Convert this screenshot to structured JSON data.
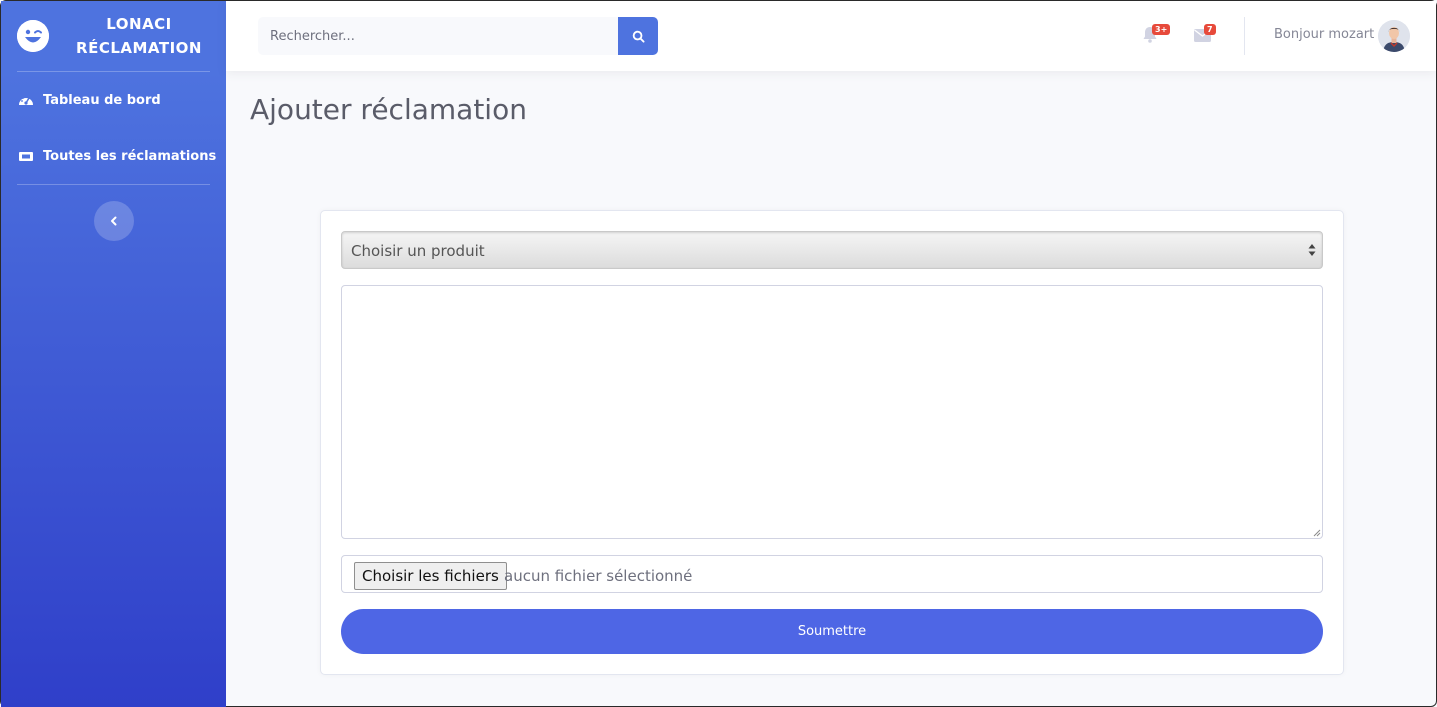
{
  "brand": {
    "line1": "LONACI",
    "line2": "RÉCLAMATION",
    "icon": "laugh-wink-icon"
  },
  "sidebar": {
    "items": [
      {
        "label": "Tableau de bord",
        "icon": "tachometer-icon"
      },
      {
        "label": "Toutes les réclamations",
        "icon": "ticket-icon"
      }
    ],
    "toggle_icon": "chevron-left-icon"
  },
  "topbar": {
    "search_placeholder": "Rechercher...",
    "search_icon": "search-icon",
    "alerts_badge": "3+",
    "messages_badge": "7",
    "greeting": "Bonjour mozart !"
  },
  "page": {
    "title": "Ajouter réclamation"
  },
  "form": {
    "product_select": "Choisir un produit",
    "description_value": "",
    "file_button": "Choisir les fichiers",
    "file_status": "aucun fichier sélectionné",
    "submit_label": "Soumettre"
  },
  "colors": {
    "primary": "#4e73df",
    "badge": "#e74a3b"
  }
}
